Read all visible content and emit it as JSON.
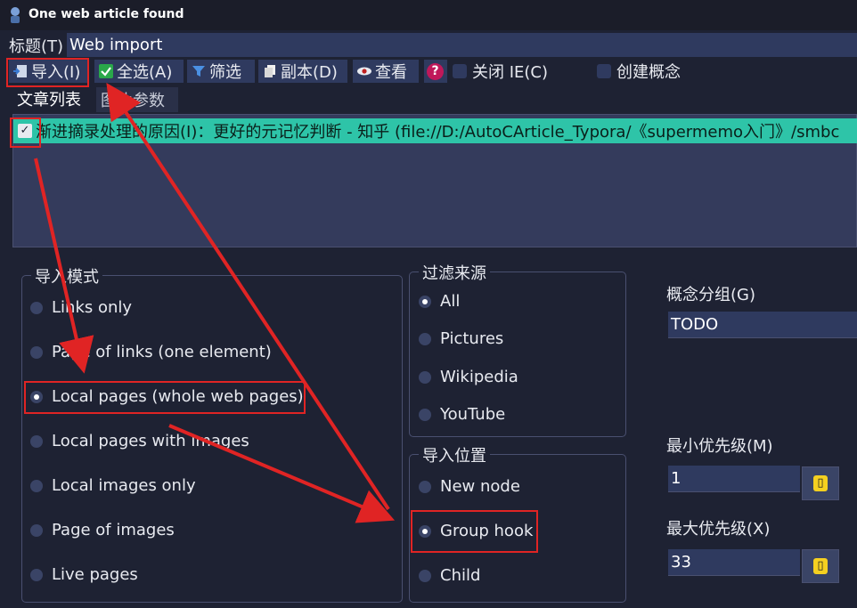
{
  "window": {
    "title": "One web article found"
  },
  "title_row": {
    "label": "标题(T)",
    "value": "Web import"
  },
  "toolbar": {
    "import": "导入(I)",
    "select_all": "全选(A)",
    "filter": "筛选",
    "copy": "副本(D)",
    "view": "查看",
    "help": "?",
    "close_ie": "关闭 IE(C)",
    "create_concept": "创建概念"
  },
  "tabs": [
    "文章列表",
    "图片参数"
  ],
  "list": {
    "items": [
      {
        "checked": true,
        "text": "渐进摘录处理的原因(I)：更好的元记忆判断 - 知乎 (file://D:/AutoCArticle_Typora/《supermemo入门》/smbc"
      }
    ]
  },
  "import_mode": {
    "title": "导入模式",
    "options": [
      "Links only",
      "Page of links (one element)",
      "Local pages (whole web pages)",
      "Local pages with images",
      "Local images only",
      "Page of images",
      "Live pages"
    ],
    "selected_index": 2
  },
  "filter_source": {
    "title": "过滤来源",
    "options": [
      "All",
      "Pictures",
      "Wikipedia",
      "YouTube"
    ],
    "selected_index": 0
  },
  "import_location": {
    "title": "导入位置",
    "options": [
      "New node",
      "Group hook",
      "Child"
    ],
    "selected_index": 1
  },
  "concept_group": {
    "label": "概念分组(G)",
    "value": "TODO"
  },
  "min_priority": {
    "label": "最小优先级(M)",
    "value": "1"
  },
  "max_priority": {
    "label": "最大优先级(X)",
    "value": "33"
  },
  "colors": {
    "accent_row": "#2ec4a8",
    "annotation": "#e02424",
    "field_bg": "#2f3a5f"
  }
}
